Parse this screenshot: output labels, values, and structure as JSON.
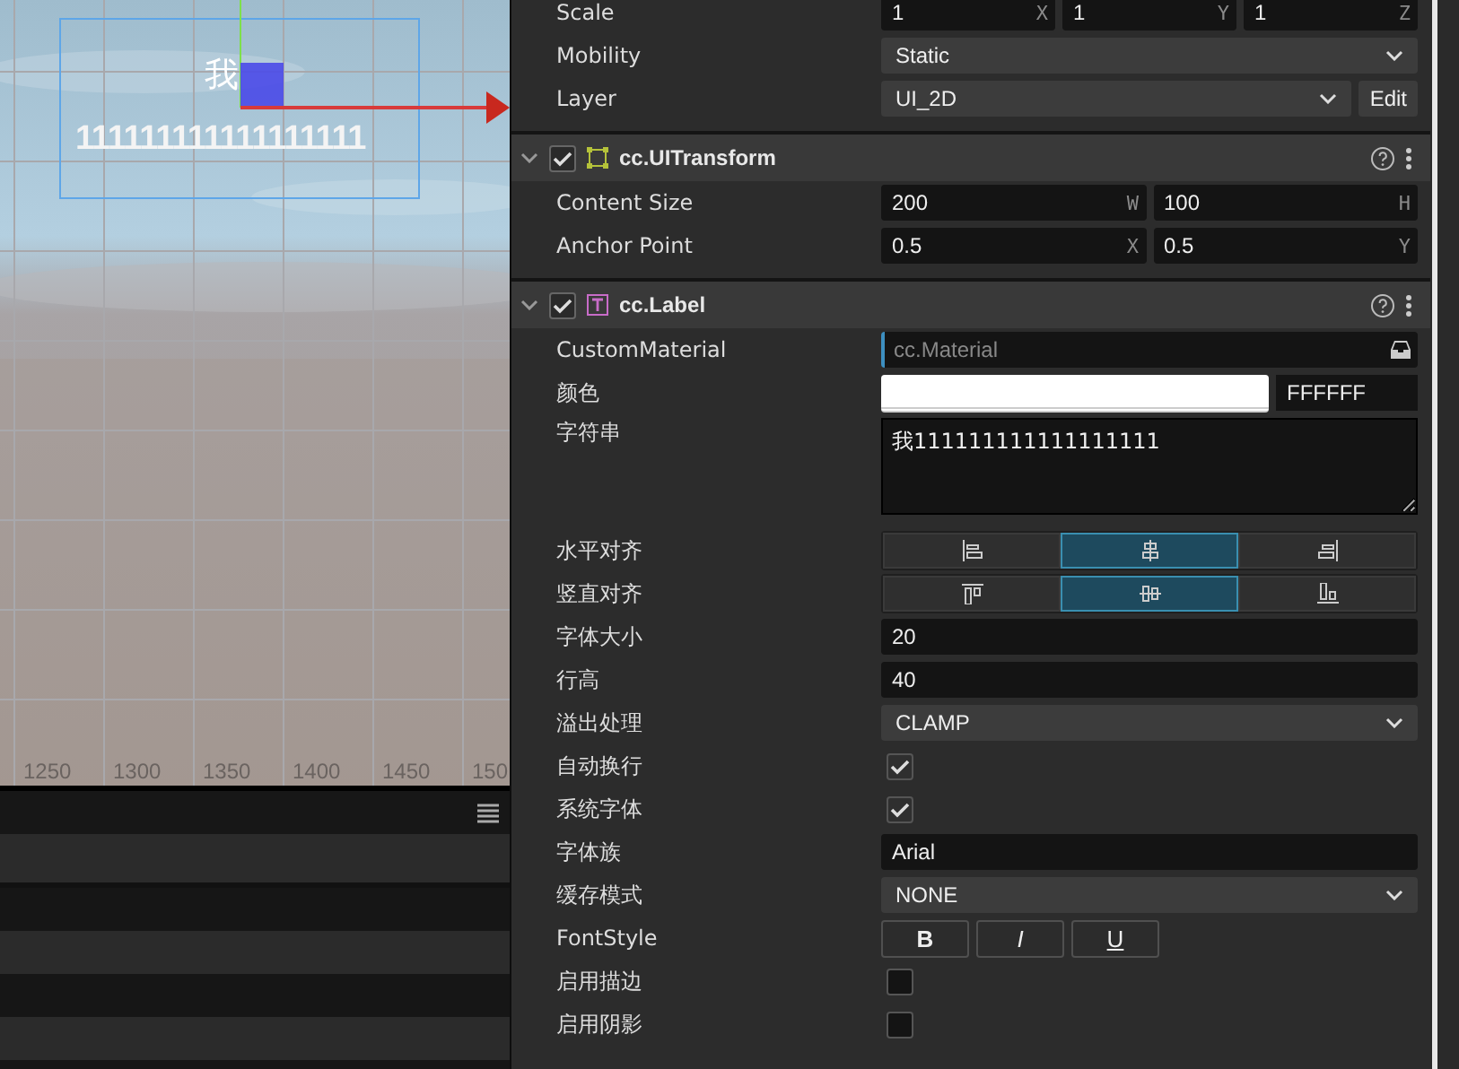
{
  "scene": {
    "node_char": "我",
    "node_text": "111111111111111111",
    "ruler_labels": [
      "1250",
      "1300",
      "1350",
      "1400",
      "1450",
      "150"
    ]
  },
  "inspector": {
    "top_rows": [
      {
        "kind": "vec",
        "label": "Scale",
        "fields": [
          {
            "value": "1",
            "axis": "X"
          },
          {
            "value": "1",
            "axis": "Y"
          },
          {
            "value": "1",
            "axis": "Z"
          }
        ]
      },
      {
        "kind": "select",
        "label": "Mobility",
        "value": "Static"
      },
      {
        "kind": "select",
        "label": "Layer",
        "value": "UI_2D",
        "button": "Edit"
      }
    ],
    "components": [
      {
        "title": "cc.UITransform",
        "kind": "transform",
        "enabled": true,
        "rows": [
          {
            "kind": "vec",
            "label": "Content Size",
            "fields": [
              {
                "value": "200",
                "axis": "W"
              },
              {
                "value": "100",
                "axis": "H"
              }
            ]
          },
          {
            "kind": "vec",
            "label": "Anchor Point",
            "fields": [
              {
                "value": "0.5",
                "axis": "X"
              },
              {
                "value": "0.5",
                "axis": "Y"
              }
            ]
          }
        ]
      },
      {
        "title": "cc.Label",
        "kind": "label",
        "enabled": true,
        "rows": [
          {
            "kind": "asset",
            "label": "CustomMaterial",
            "placeholder": "cc.Material"
          },
          {
            "kind": "color",
            "label": "颜色",
            "color": "#ffffff",
            "hex": "FFFFFF"
          },
          {
            "kind": "textarea",
            "label": "字符串",
            "value": "我111111111111111111"
          },
          {
            "kind": "h-align",
            "label": "水平对齐",
            "options": [
              {
                "selected": false
              },
              {
                "selected": true
              },
              {
                "selected": false
              }
            ]
          },
          {
            "kind": "v-align",
            "label": "竖直对齐",
            "options": [
              {
                "selected": false
              },
              {
                "selected": true
              },
              {
                "selected": false
              }
            ]
          },
          {
            "kind": "input",
            "label": "字体大小",
            "value": "20"
          },
          {
            "kind": "input",
            "label": "行高",
            "value": "40"
          },
          {
            "kind": "select",
            "label": "溢出处理",
            "value": "CLAMP"
          },
          {
            "kind": "checkbox",
            "label": "自动换行",
            "checked": true
          },
          {
            "kind": "checkbox",
            "label": "系统字体",
            "checked": true
          },
          {
            "kind": "input",
            "label": "字体族",
            "value": "Arial"
          },
          {
            "kind": "select",
            "label": "缓存模式",
            "value": "NONE"
          },
          {
            "kind": "fontstyle",
            "label": "FontStyle",
            "buttons": [
              {
                "label": "B",
                "kind": "bold"
              },
              {
                "label": "I",
                "kind": "italic"
              },
              {
                "label": "U",
                "kind": "underline"
              }
            ]
          },
          {
            "kind": "checkbox",
            "label": "启用描边",
            "checked": false
          },
          {
            "kind": "checkbox",
            "label": "启用阴影",
            "checked": false
          }
        ]
      }
    ]
  }
}
